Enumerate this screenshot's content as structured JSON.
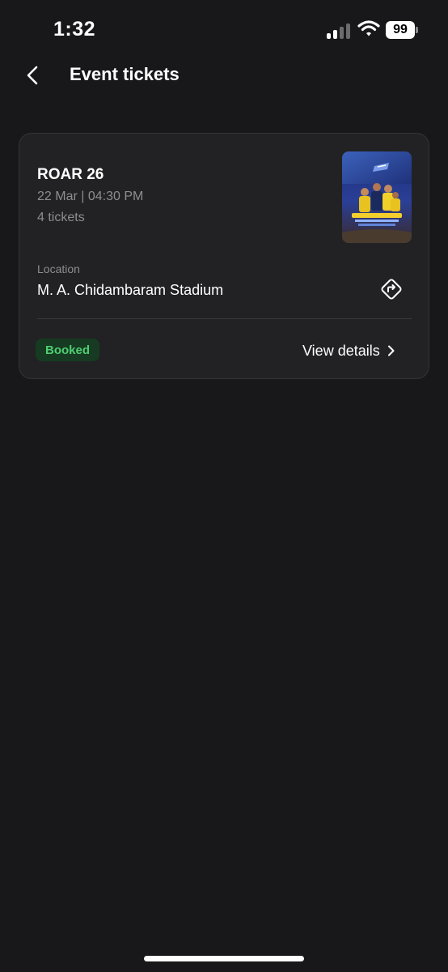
{
  "status_bar": {
    "time": "1:32",
    "battery": "99",
    "icons": [
      "cellular-signal-icon",
      "wifi-icon",
      "battery-icon"
    ]
  },
  "header": {
    "title": "Event tickets",
    "back_icon": "chevron-left-icon"
  },
  "ticket": {
    "title": "ROAR 26",
    "datetime": "22 Mar | 04:30 PM",
    "tickets": "4 tickets",
    "poster_icon": "event-poster-image",
    "location_label": "Location",
    "location": "M. A. Chidambaram Stadium",
    "directions_icon": "directions-icon",
    "status": "Booked",
    "action_label": "View details",
    "action_icon": "chevron-right-icon"
  },
  "colors": {
    "background": "#18181a",
    "card": "#222224",
    "muted_text": "#8d8d92",
    "badge_bg": "#163b22",
    "badge_text": "#4fce72"
  }
}
